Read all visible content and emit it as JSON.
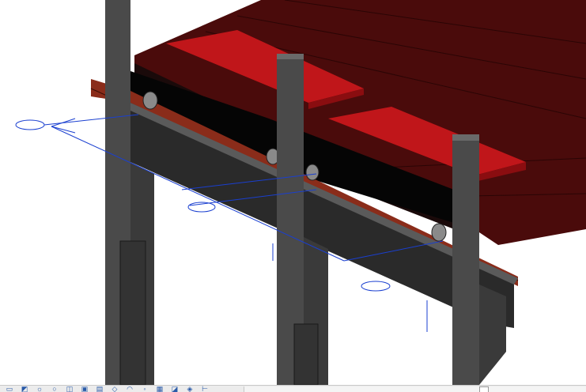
{
  "view": {
    "type": "3D view",
    "colors": {
      "roof": "#4a0b0b",
      "plate": "#c0161a",
      "column": "#3e3e3e",
      "beam": "#2a2a2a",
      "rail": "#8a2c1a",
      "annotation": "#1a3fd0"
    }
  },
  "view_control_bar": {
    "icons": [
      "scale-icon",
      "detail-level-icon",
      "visual-style-icon",
      "sun-path-icon",
      "shadows-icon",
      "crop-view-icon",
      "show-crop-icon",
      "unlock-3d-icon",
      "temporary-hide-icon",
      "reveal-hidden-icon",
      "worksharing-icon",
      "design-options-icon",
      "analytical-model-icon",
      "highlight-displacement-icon",
      "reveal-constraints-icon"
    ]
  }
}
